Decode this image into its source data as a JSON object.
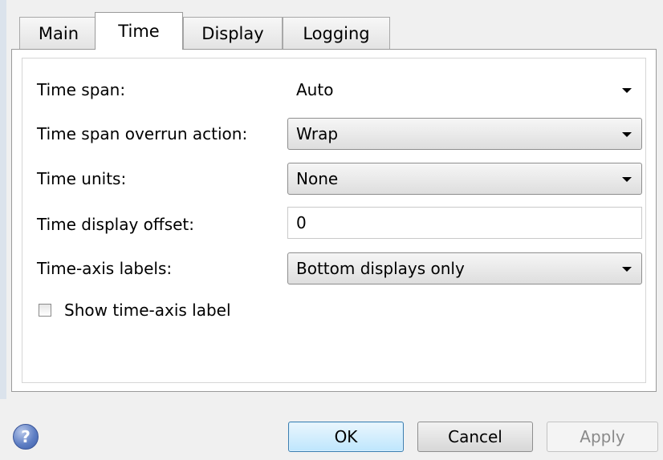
{
  "tabs": [
    {
      "label": "Main",
      "active": false
    },
    {
      "label": "Time",
      "active": true
    },
    {
      "label": "Display",
      "active": false
    },
    {
      "label": "Logging",
      "active": false
    }
  ],
  "form": {
    "time_span": {
      "label": "Time span:",
      "value": "Auto"
    },
    "overrun_action": {
      "label": "Time span overrun action:",
      "value": "Wrap"
    },
    "time_units": {
      "label": "Time units:",
      "value": "None"
    },
    "display_offset": {
      "label": "Time display offset:",
      "value": "0"
    },
    "axis_labels": {
      "label": "Time-axis labels:",
      "value": "Bottom displays only"
    },
    "show_axis_label": {
      "label": "Show time-axis label",
      "checked": false
    }
  },
  "buttons": {
    "help": "?",
    "ok": "OK",
    "cancel": "Cancel",
    "apply": "Apply"
  },
  "icons": {
    "dropdown": "chevron-down-icon",
    "help": "help-icon"
  },
  "colors": {
    "ok_border": "#3c7fb1",
    "help_icon": "#5f7fc4",
    "disabled_text": "#8a8a8a"
  }
}
